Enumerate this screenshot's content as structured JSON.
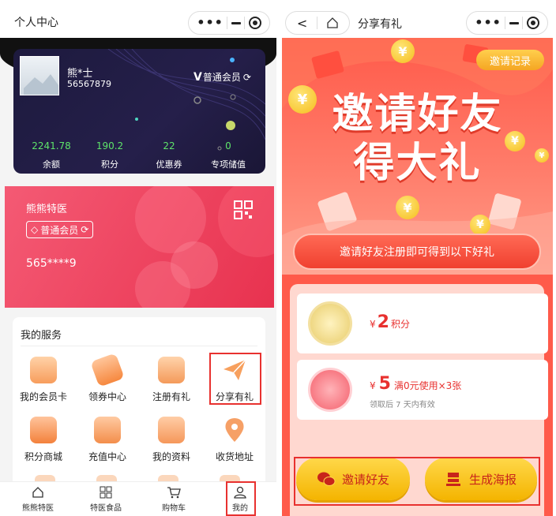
{
  "left": {
    "title": "个人中心",
    "user": {
      "name": "熊*士",
      "id": "56567879",
      "level": "普通会员"
    },
    "stats": [
      {
        "value": "2241.78",
        "label": "余额"
      },
      {
        "value": "190.2",
        "label": "积分"
      },
      {
        "value": "22",
        "label": "优惠券"
      },
      {
        "value": "0",
        "label": "专项储值"
      }
    ],
    "member_card": {
      "shop": "熊熊特医",
      "level": "普通会员",
      "number": "565****9"
    },
    "services": {
      "title": "我的服务",
      "items": [
        {
          "label": "我的会员卡",
          "icon": "crown-icon"
        },
        {
          "label": "领券中心",
          "icon": "coupon-icon"
        },
        {
          "label": "注册有礼",
          "icon": "gift-icon"
        },
        {
          "label": "分享有礼",
          "icon": "paper-plane-icon"
        },
        {
          "label": "积分商城",
          "icon": "points-shop-icon"
        },
        {
          "label": "充值中心",
          "icon": "recharge-icon"
        },
        {
          "label": "我的资料",
          "icon": "profile-doc-icon"
        },
        {
          "label": "收货地址",
          "icon": "location-pin-icon"
        }
      ]
    },
    "tabs": [
      {
        "label": "熊熊特医",
        "icon": "home-icon"
      },
      {
        "label": "特医食品",
        "icon": "grid-icon"
      },
      {
        "label": "购物车",
        "icon": "cart-icon"
      },
      {
        "label": "我的",
        "icon": "user-icon"
      }
    ]
  },
  "right": {
    "title": "分享有礼",
    "invite_record": "邀请记录",
    "hero_line1": "邀请好友",
    "hero_line2": "得大礼",
    "banner": "邀请好友注册即可得到以下好礼",
    "gift1": {
      "currency": "¥",
      "amount": "2",
      "unit": "积分"
    },
    "gift2": {
      "currency": "¥",
      "amount": "5",
      "desc": "满0元使用×3张",
      "validity": "领取后 7 天内有效"
    },
    "invite_button": "邀请好友",
    "poster_button": "生成海报"
  },
  "colors": {
    "accent_red": "#e8312f",
    "green_value": "#5ee46a",
    "gold": "#f4b400"
  }
}
